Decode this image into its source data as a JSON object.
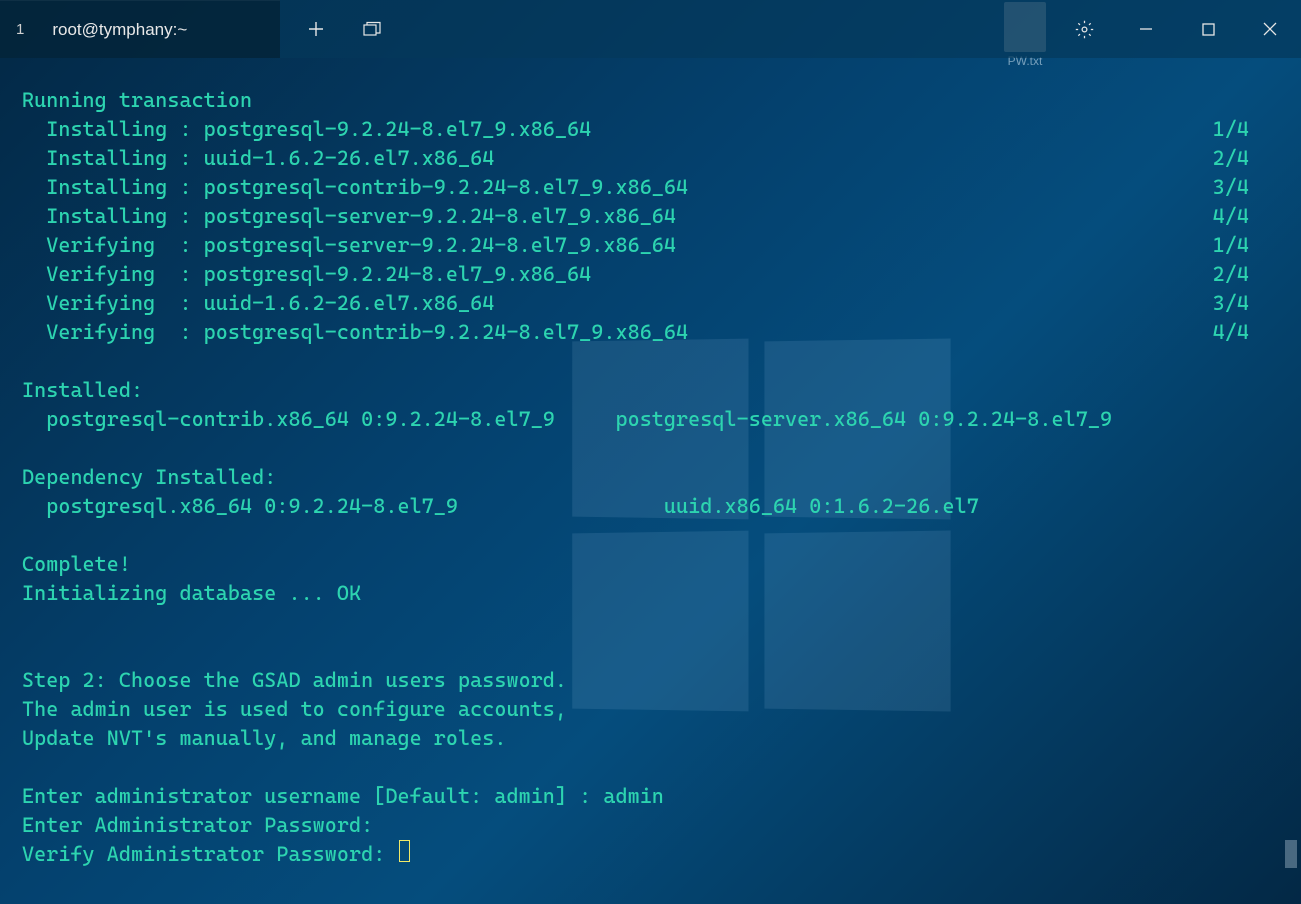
{
  "titlebar": {
    "tab_index": "1",
    "tab_title": "root@tymphany:~"
  },
  "desktop": {
    "file_label": "PW.txt"
  },
  "terminal": {
    "header": "Running transaction",
    "install_rows": [
      {
        "label": "  Installing : postgresql-9.2.24-8.el7_9.x86_64",
        "progress": "1/4"
      },
      {
        "label": "  Installing : uuid-1.6.2-26.el7.x86_64",
        "progress": "2/4"
      },
      {
        "label": "  Installing : postgresql-contrib-9.2.24-8.el7_9.x86_64",
        "progress": "3/4"
      },
      {
        "label": "  Installing : postgresql-server-9.2.24-8.el7_9.x86_64",
        "progress": "4/4"
      },
      {
        "label": "  Verifying  : postgresql-server-9.2.24-8.el7_9.x86_64",
        "progress": "1/4"
      },
      {
        "label": "  Verifying  : postgresql-9.2.24-8.el7_9.x86_64",
        "progress": "2/4"
      },
      {
        "label": "  Verifying  : uuid-1.6.2-26.el7.x86_64",
        "progress": "3/4"
      },
      {
        "label": "  Verifying  : postgresql-contrib-9.2.24-8.el7_9.x86_64",
        "progress": "4/4"
      }
    ],
    "installed_header": "Installed:",
    "installed_line": "  postgresql-contrib.x86_64 0:9.2.24-8.el7_9     postgresql-server.x86_64 0:9.2.24-8.el7_9",
    "dep_header": "Dependency Installed:",
    "dep_line": "  postgresql.x86_64 0:9.2.24-8.el7_9                 uuid.x86_64 0:1.6.2-26.el7",
    "complete": "Complete!",
    "init_db": "Initializing database ... OK",
    "step2_1": "Step 2: Choose the GSAD admin users password.",
    "step2_2": "The admin user is used to configure accounts,",
    "step2_3": "Update NVT's manually, and manage roles.",
    "enter_user": "Enter administrator username [Default: admin] : admin",
    "enter_pw": "Enter Administrator Password:",
    "verify_pw": "Verify Administrator Password: "
  }
}
